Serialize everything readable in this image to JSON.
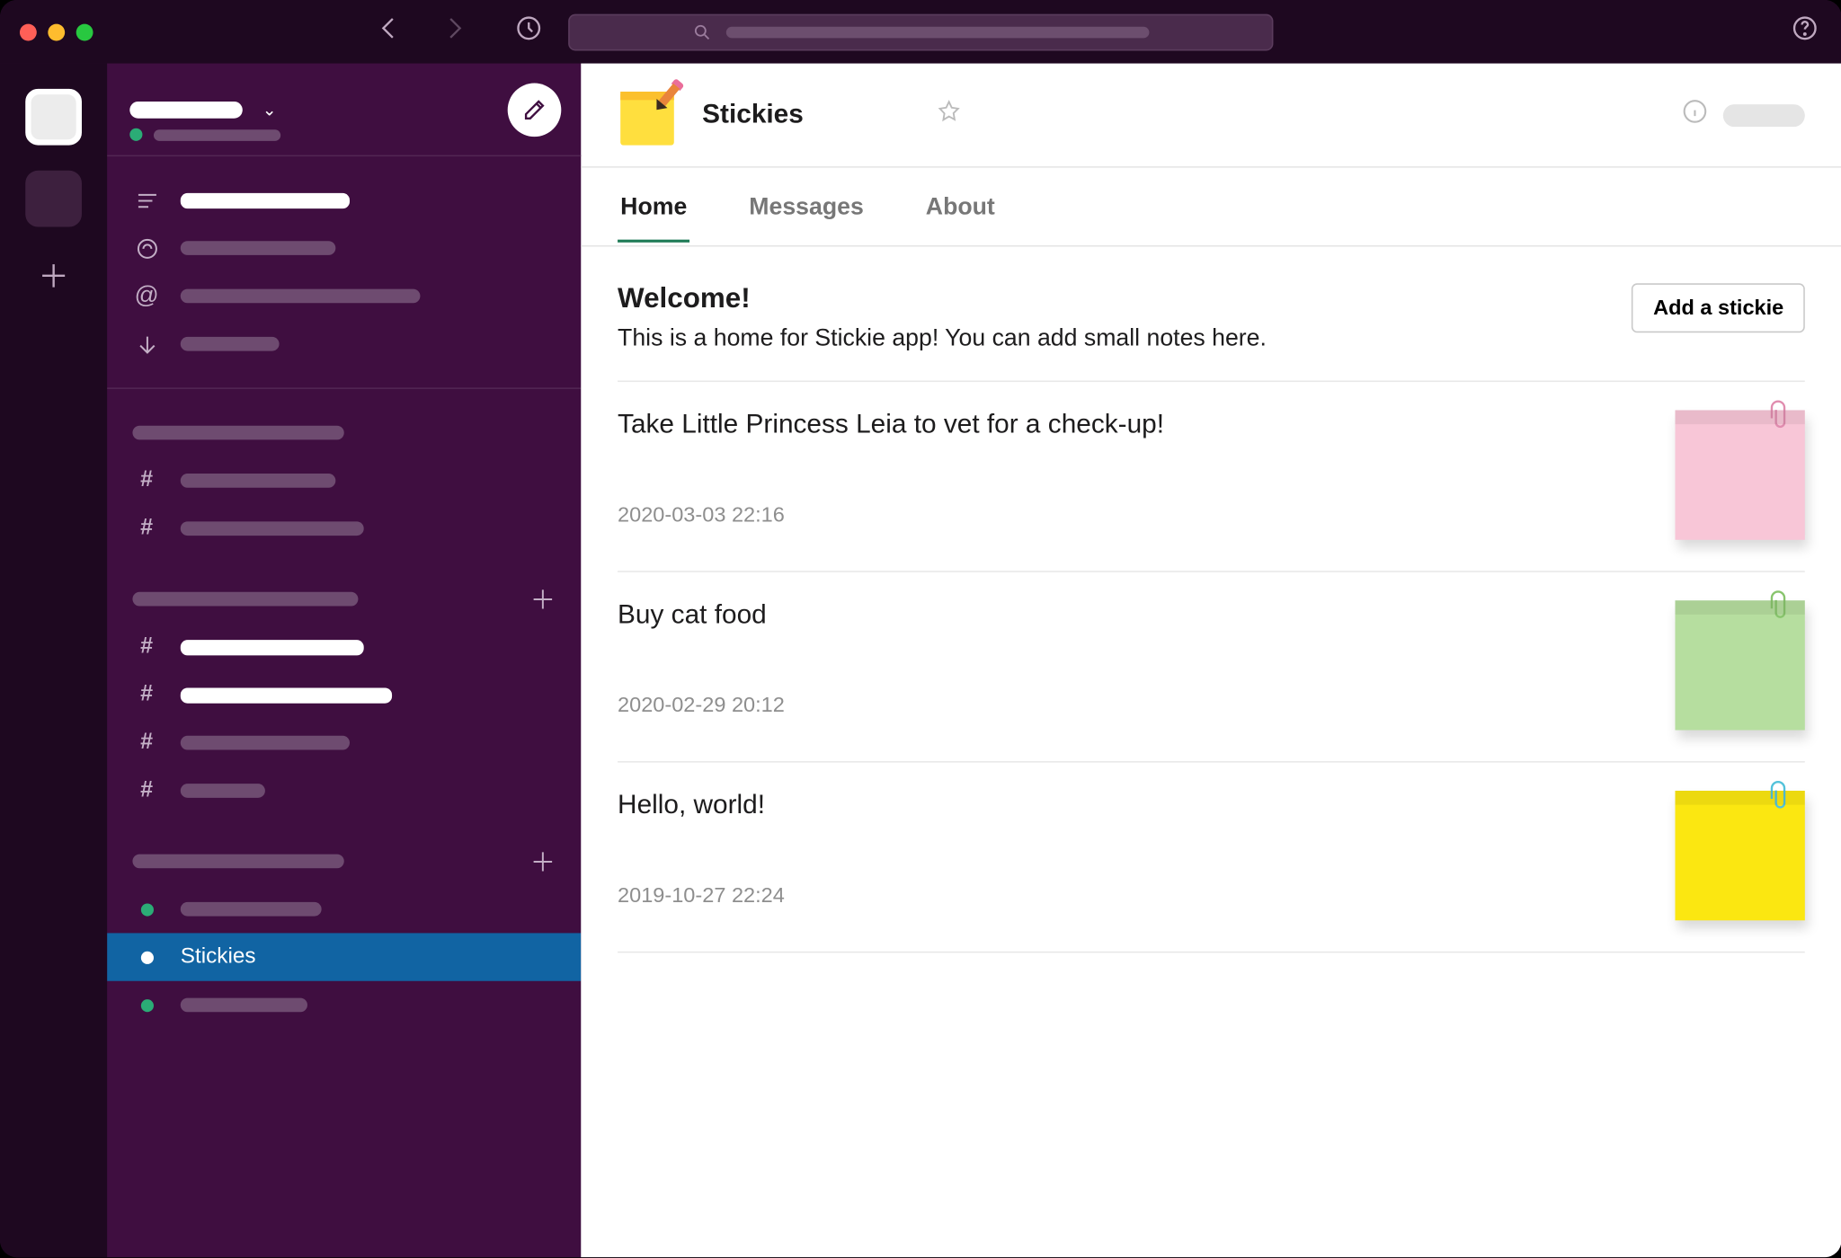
{
  "colors": {
    "sidebar": "#3F0E40",
    "accent": "#1164A3",
    "presence": "#2BAC76"
  },
  "sidebar": {
    "selected_label": "Stickies"
  },
  "app": {
    "title": "Stickies",
    "tabs": {
      "home": "Home",
      "messages": "Messages",
      "about": "About"
    },
    "welcome_title": "Welcome!",
    "welcome_desc": "This is a home for Stickie app! You can add small notes here.",
    "add_button": "Add a stickie",
    "stickies": [
      {
        "text": "Take Little Princess Leia to vet for a check-up!",
        "timestamp": "2020-03-03 22:16",
        "color": "pink"
      },
      {
        "text": "Buy cat food",
        "timestamp": "2020-02-29 20:12",
        "color": "green"
      },
      {
        "text": "Hello, world!",
        "timestamp": "2019-10-27 22:24",
        "color": "yellow"
      }
    ]
  }
}
